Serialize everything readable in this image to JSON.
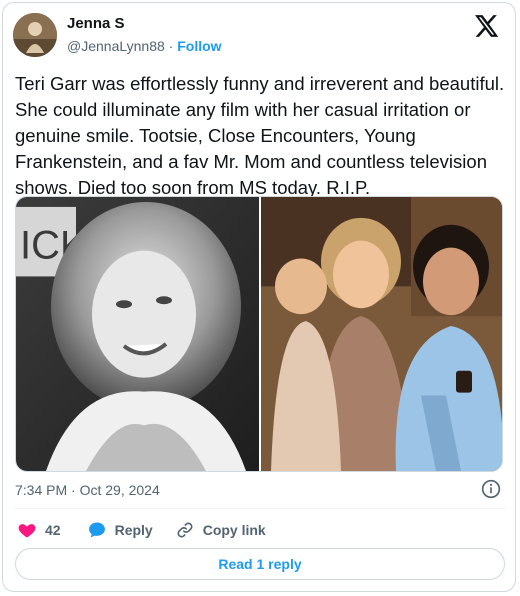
{
  "author": {
    "name": "Jenna S",
    "handle": "@JennaLynn88",
    "separator": " · ",
    "follow_label": "Follow"
  },
  "tweet": {
    "text": "Teri Garr was effortlessly funny and irreverent and beautiful. She could illuminate any film with her casual irritation or genuine smile. Tootsie, Close Encounters, Young Frankenstein, and a fav Mr. Mom and countless television shows. Died too soon from MS today. R.I.P.",
    "timestamp": "7:34 PM · Oct 29, 2024"
  },
  "media": {
    "left_sign_text": "ICK"
  },
  "actions": {
    "like_count": "42",
    "reply_label": "Reply",
    "copy_link_label": "Copy link"
  },
  "read_reply_label": "Read 1 reply",
  "colors": {
    "accent": "#1d9bf0",
    "like": "#f91880",
    "text_primary": "#0f1419",
    "text_secondary": "#536471",
    "border": "#cfd9de"
  },
  "icons": {
    "brand": "x-logo-icon",
    "info": "info-icon",
    "like": "heart-icon",
    "reply": "speech-bubble-icon",
    "copy": "link-icon"
  }
}
